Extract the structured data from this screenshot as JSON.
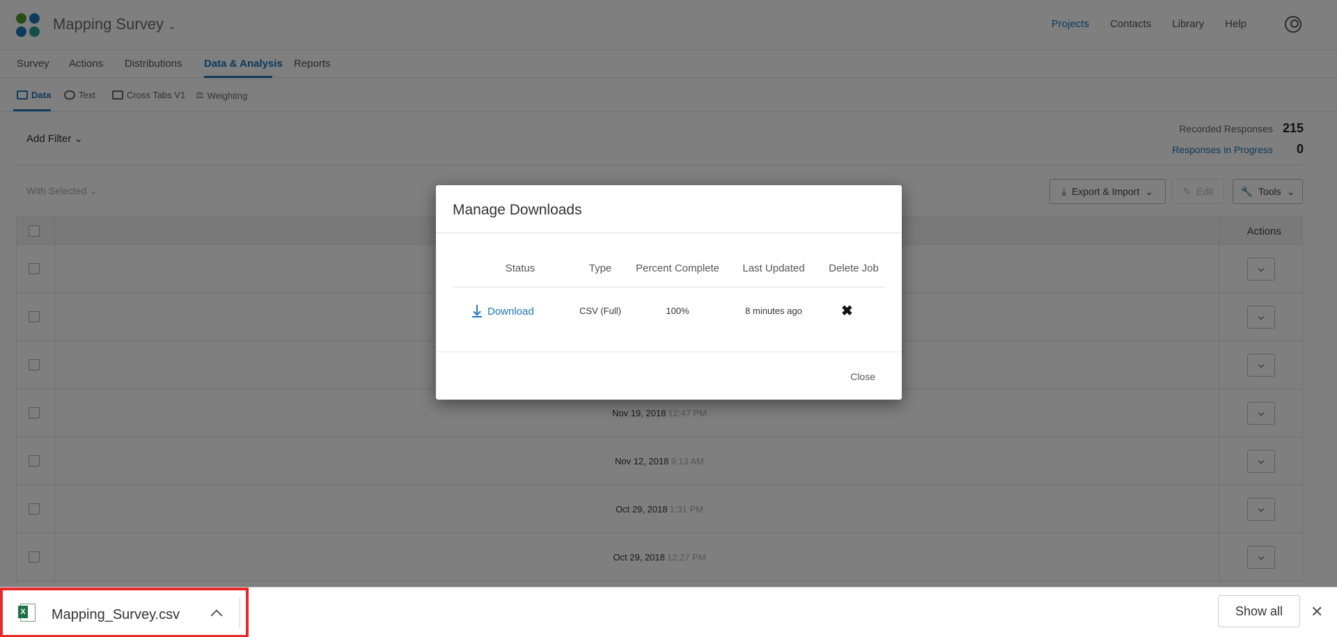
{
  "header": {
    "survey_title": "Mapping Survey",
    "nav": [
      "Projects",
      "Contacts",
      "Library",
      "Help"
    ],
    "active_nav": "Projects"
  },
  "tabs": [
    "Survey",
    "Actions",
    "Distributions",
    "Data & Analysis",
    "Reports"
  ],
  "active_tab": "Data & Analysis",
  "subtabs": [
    "Data",
    "Text",
    "Cross Tabs V1",
    "Weighting"
  ],
  "active_subtab": "Data",
  "filter": {
    "add_filter_label": "Add Filter"
  },
  "stats": {
    "recorded_label": "Recorded Responses",
    "recorded_value": "215",
    "in_progress_label": "Responses in Progress",
    "in_progress_value": "0"
  },
  "toolbar": {
    "with_selected": "With Selected",
    "export_import": "Export & Import",
    "edit": "Edit",
    "tools": "Tools"
  },
  "table": {
    "actions_header": "Actions",
    "rows": [
      {
        "date": "",
        "time": ""
      },
      {
        "date": "",
        "time": ""
      },
      {
        "date": "",
        "time": ""
      },
      {
        "date": "Nov 19, 2018",
        "time": "12:47 PM"
      },
      {
        "date": "Nov 12, 2018",
        "time": "9:13 AM"
      },
      {
        "date": "Oct 29, 2018",
        "time": "1:31 PM"
      },
      {
        "date": "Oct 29, 2018",
        "time": "12:27 PM"
      }
    ]
  },
  "modal": {
    "title": "Manage Downloads",
    "headers": [
      "Status",
      "Type",
      "Percent Complete",
      "Last Updated",
      "Delete Job"
    ],
    "job": {
      "status_link": "Download",
      "type": "CSV (Full)",
      "percent": "100%",
      "last_updated": "8 minutes ago",
      "delete_glyph": "✖"
    },
    "close_label": "Close"
  },
  "download_bar": {
    "file_name": "Mapping_Survey.csv",
    "show_all": "Show all",
    "close_glyph": "✕"
  },
  "colors": {
    "accent": "#1c74b9",
    "highlight": "#e8282b"
  }
}
